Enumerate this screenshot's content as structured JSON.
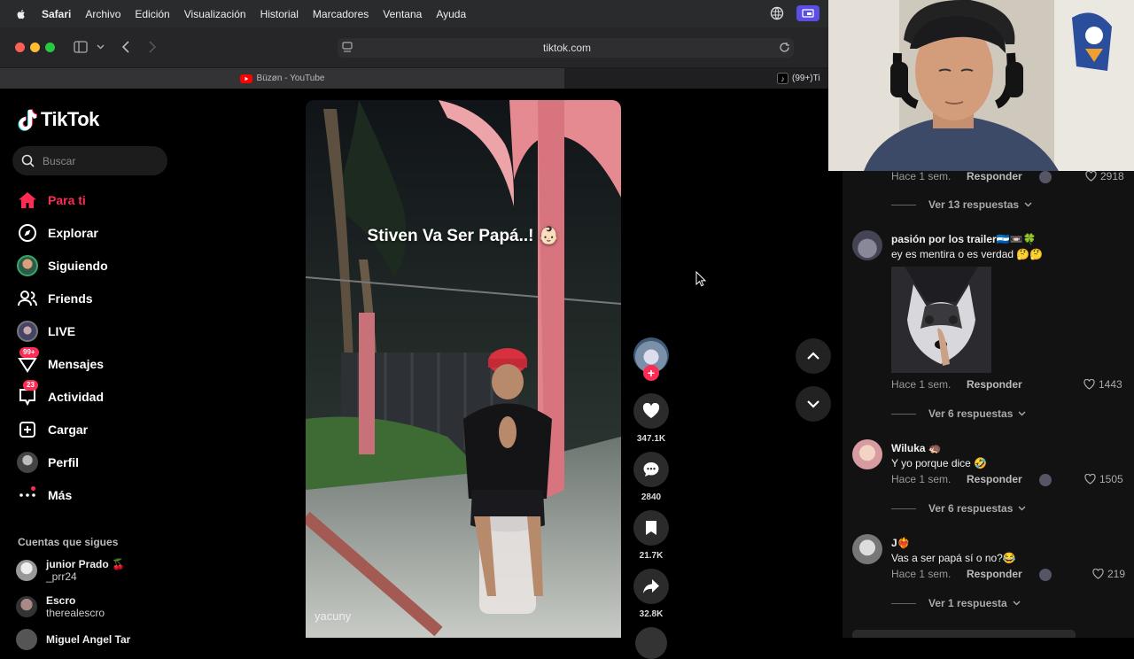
{
  "menubar": {
    "app": "Safari",
    "items": [
      "Archivo",
      "Edición",
      "Visualización",
      "Historial",
      "Marcadores",
      "Ventana",
      "Ayuda"
    ]
  },
  "browser": {
    "url": "tiktok.com",
    "tabs": [
      {
        "title": "Büzøn - YouTube"
      },
      {
        "title": "(99+)Ti"
      }
    ]
  },
  "tiktok": {
    "logo": "TikTok",
    "search_placeholder": "Buscar",
    "nav": [
      {
        "label": "Para ti",
        "icon": "home-icon"
      },
      {
        "label": "Explorar",
        "icon": "compass-icon"
      },
      {
        "label": "Siguiendo",
        "icon": "avatar"
      },
      {
        "label": "Friends",
        "icon": "friends-icon"
      },
      {
        "label": "LIVE",
        "icon": "live-icon"
      },
      {
        "label": "Mensajes",
        "icon": "messages-icon",
        "badge": "99+"
      },
      {
        "label": "Actividad",
        "icon": "activity-icon",
        "badge": "23"
      },
      {
        "label": "Cargar",
        "icon": "upload-icon"
      },
      {
        "label": "Perfil",
        "icon": "profile-icon"
      },
      {
        "label": "Más",
        "icon": "more-icon"
      }
    ],
    "following_title": "Cuentas que sigues",
    "following": [
      {
        "name": "junior Prado 🍒",
        "handle": "_prr24"
      },
      {
        "name": "Escro",
        "handle": "therealescro"
      },
      {
        "name": "Miguel Angel Tar",
        "handle": ""
      }
    ],
    "video": {
      "caption": "Stiven Va Ser Papá..! 👶🏻",
      "author": "yacuny",
      "likes": "347.1K",
      "comments": "2840",
      "saves": "21.7K",
      "shares": "32.8K"
    },
    "comments": [
      {
        "name": "",
        "text": "",
        "time": "Hace 1 sem.",
        "reply": "Responder",
        "likes": "2918",
        "more": "Ver 13 respuestas"
      },
      {
        "name": "pasión por los trailer🇳🇮📼🍀",
        "text": "ey es mentira o es verdad 🤔🤔",
        "time": "Hace 1 sem.",
        "reply": "Responder",
        "likes": "1443",
        "more": "Ver 6 respuestas"
      },
      {
        "name": "Wiluka 🦔",
        "text": "Y yo porque dice 🤣",
        "time": "Hace 1 sem.",
        "reply": "Responder",
        "likes": "1505",
        "more": "Ver 6 respuestas"
      },
      {
        "name": "J❤️‍🔥",
        "text": "Vas a ser papá sí o no?😂",
        "time": "Hace 1 sem.",
        "reply": "Responder",
        "likes": "219",
        "more": "Ver 1 respuesta"
      }
    ]
  },
  "colors": {
    "accent": "#fe2c55",
    "bg": "#000000",
    "panel": "#121212"
  }
}
